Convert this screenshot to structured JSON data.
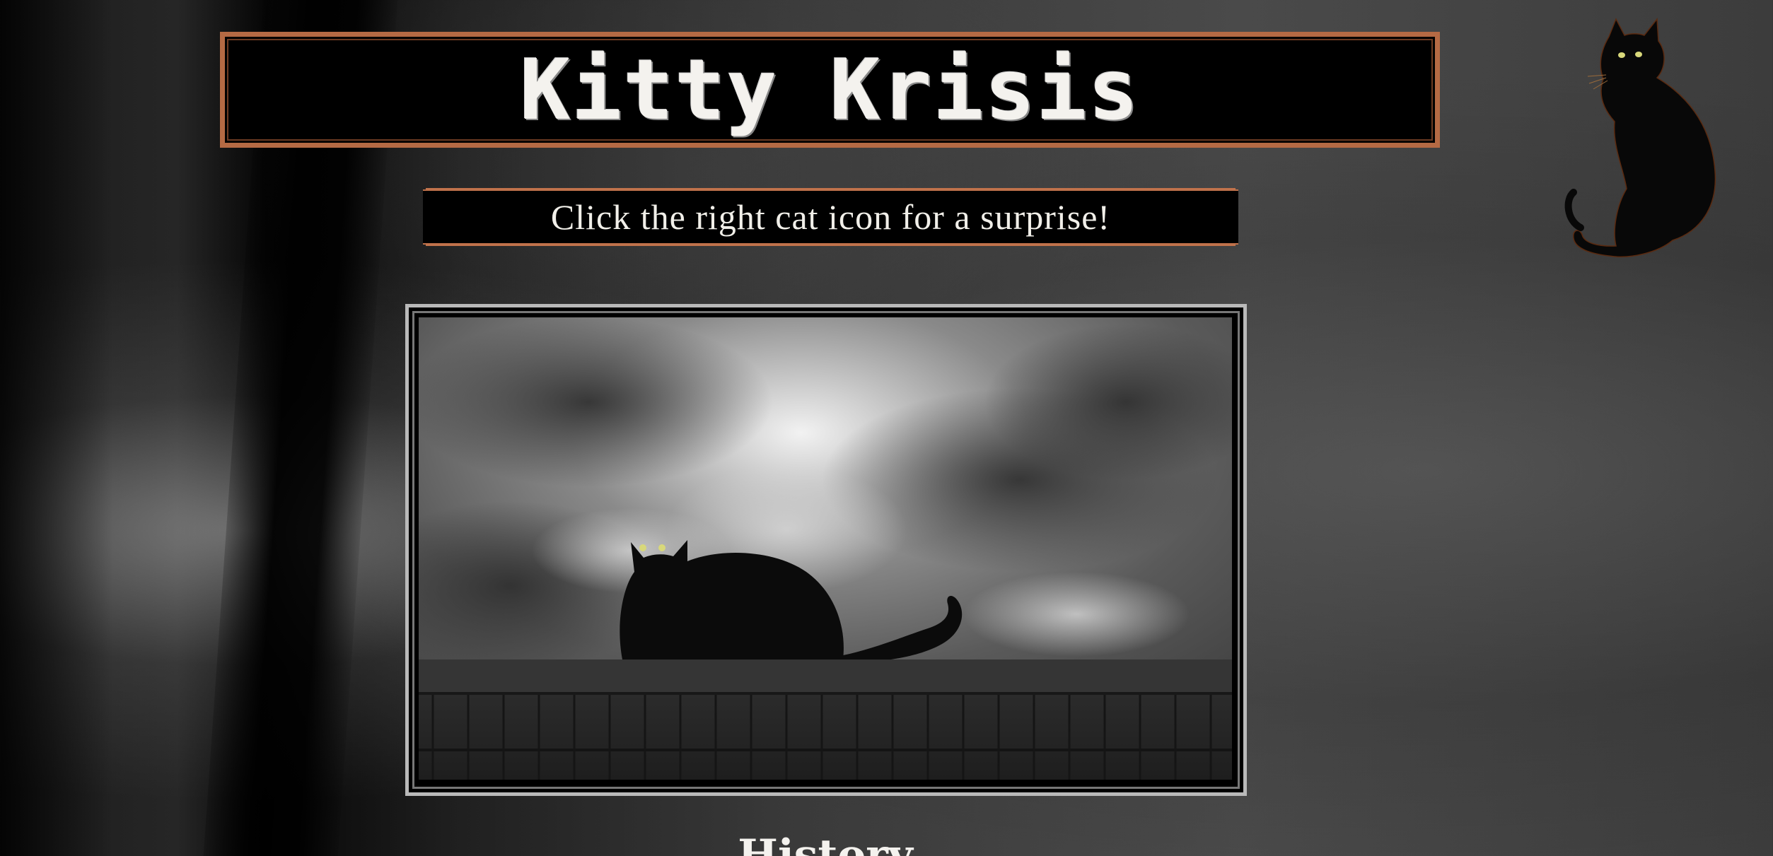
{
  "header": {
    "title": "Kitty Krisis",
    "subtitle": "Click the right cat icon for a surprise!"
  },
  "hero_image": {
    "subject": "black-cat-on-fence-under-storm-clouds"
  },
  "corner_icon": {
    "icon": "black-cat-icon"
  },
  "section": {
    "heading": "History"
  },
  "colors": {
    "frame_accent": "#b56a44",
    "cat_eyes": "#d8d87a",
    "text": "#f4f2ee"
  }
}
